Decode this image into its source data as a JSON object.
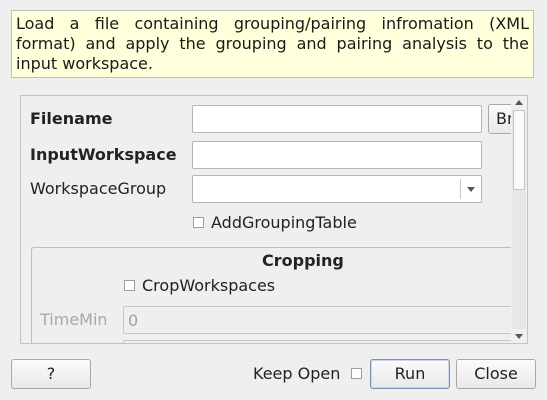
{
  "description": "Load a file containing grouping/pairing infromation (XML format) and apply the grouping and pairing analysis to the input workspace.",
  "properties": {
    "filename": {
      "label": "Filename",
      "value": "",
      "browse_label": "Browse"
    },
    "input_workspace": {
      "label": "InputWorkspace",
      "value": ""
    },
    "workspace_group": {
      "label": "WorkspaceGroup",
      "value": ""
    },
    "add_grouping_table": {
      "label": "AddGroupingTable",
      "checked": false
    }
  },
  "cropping": {
    "title": "Cropping",
    "crop_workspaces": {
      "label": "CropWorkspaces",
      "checked": false
    },
    "time_min": {
      "label": "TimeMin",
      "value": "0"
    }
  },
  "footer": {
    "help_label": "?",
    "keep_open_label": "Keep Open",
    "keep_open_checked": false,
    "run_label": "Run",
    "close_label": "Close"
  },
  "icons": {
    "combo_arrow": "chevron-down-icon",
    "scroll_up": "chevron-up-icon",
    "scroll_down": "chevron-down-icon"
  }
}
